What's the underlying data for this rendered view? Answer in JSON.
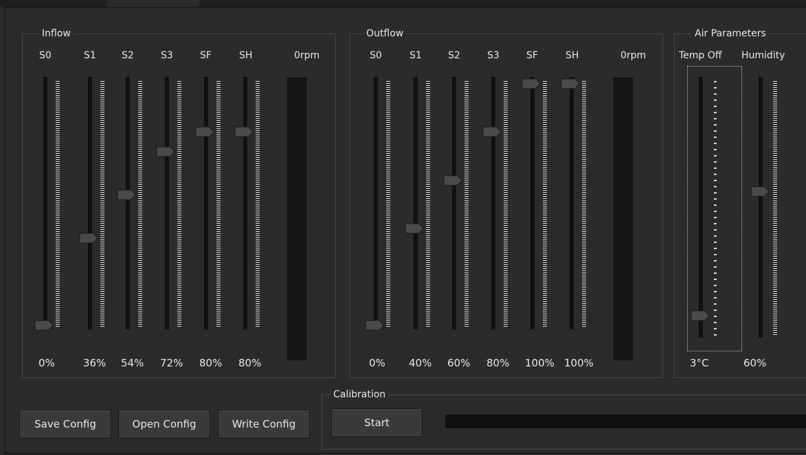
{
  "inflow": {
    "title": "Inflow",
    "rpm_label": "0rpm",
    "sliders": [
      {
        "label": "S0",
        "value_text": "0%",
        "fraction": 0.0
      },
      {
        "label": "S1",
        "value_text": "36%",
        "fraction": 0.36
      },
      {
        "label": "S2",
        "value_text": "54%",
        "fraction": 0.54
      },
      {
        "label": "S3",
        "value_text": "72%",
        "fraction": 0.72
      },
      {
        "label": "SF",
        "value_text": "80%",
        "fraction": 0.8
      },
      {
        "label": "SH",
        "value_text": "80%",
        "fraction": 0.8
      }
    ]
  },
  "outflow": {
    "title": "Outflow",
    "rpm_label": "0rpm",
    "sliders": [
      {
        "label": "S0",
        "value_text": "0%",
        "fraction": 0.0
      },
      {
        "label": "S1",
        "value_text": "40%",
        "fraction": 0.4
      },
      {
        "label": "S2",
        "value_text": "60%",
        "fraction": 0.6
      },
      {
        "label": "S3",
        "value_text": "80%",
        "fraction": 0.8
      },
      {
        "label": "SF",
        "value_text": "100%",
        "fraction": 1.0
      },
      {
        "label": "SH",
        "value_text": "100%",
        "fraction": 1.0
      }
    ]
  },
  "air": {
    "title": "Air Parameters",
    "temp": {
      "label": "Temp Off",
      "value_text": "3°C",
      "fraction": 0.03
    },
    "humidity": {
      "label": "Humidity",
      "value_text": "60%",
      "fraction": 0.55
    }
  },
  "calibration": {
    "title": "Calibration",
    "start_label": "Start",
    "progress": 0.0
  },
  "buttons": {
    "save": "Save Config",
    "open": "Open Config",
    "write": "Write Config"
  },
  "colors": {
    "background": "#2b2b2b",
    "track": "#111111",
    "handle": "#4a4a4a",
    "ticks": "#dcdcdc",
    "text": "#e8e8e8"
  }
}
